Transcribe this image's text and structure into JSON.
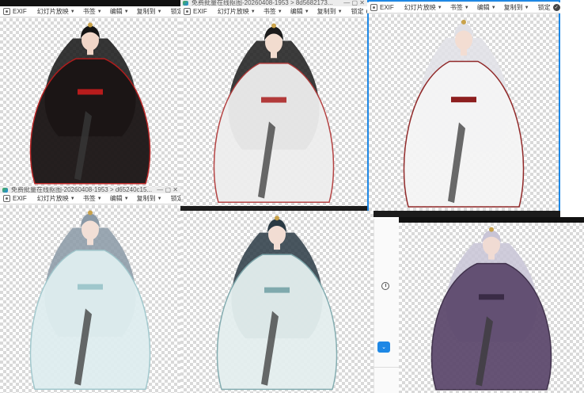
{
  "toolbar": {
    "exif_label": "EXIF",
    "menus": [
      "幻灯片放映",
      "书签",
      "编辑",
      "复制到"
    ],
    "lock_label": "锁定",
    "check_icon": "check-circle-icon"
  },
  "windows": [
    {
      "title": "",
      "selected": false
    },
    {
      "title": "免费批量在线抠图-20260408-1953 > 8d5682173...",
      "selected": false
    },
    {
      "title": "",
      "selected": true
    },
    {
      "title": "免费批量在线抠图-20260408-1953 > d65240c15...",
      "selected": false
    },
    {
      "title": "",
      "selected": false
    },
    {
      "title": "",
      "selected": false
    }
  ],
  "figures": [
    {
      "hair": "#141414",
      "robe": "#1a1414",
      "accent": "#b71c1c",
      "skin": "#f1d6c8",
      "desc_icon": "portrait-black-red-robe"
    },
    {
      "hair": "#1b1b1b",
      "robe": "#eeeeee",
      "accent": "#b23a3a",
      "skin": "#f2dccf",
      "desc_icon": "portrait-white-robe-dark-hair"
    },
    {
      "hair": "#e0e0e6",
      "robe": "#f5f5f5",
      "accent": "#8d1f1f",
      "skin": "#f3ddd2",
      "desc_icon": "portrait-white-hair-white-robe"
    },
    {
      "hair": "#8a99a6",
      "robe": "#dfeef0",
      "accent": "#9fc7cc",
      "skin": "#f2dfd6",
      "desc_icon": "portrait-silver-hair-teal-robe"
    },
    {
      "hair": "#2a3a44",
      "robe": "#e4efef",
      "accent": "#7fa9ad",
      "skin": "#f2ddd3",
      "desc_icon": "portrait-dark-teal-hair-light-robe"
    },
    {
      "hair": "#c8c4d6",
      "robe": "#5e4a6e",
      "accent": "#3a2b46",
      "skin": "#f0dbd3",
      "desc_icon": "portrait-lavender-hair-purple-robe"
    }
  ],
  "side_panel": {
    "clock_icon": "clock-icon",
    "dropdown_icon": "chevron-down-icon",
    "dropdown_glyph": "⌄"
  }
}
